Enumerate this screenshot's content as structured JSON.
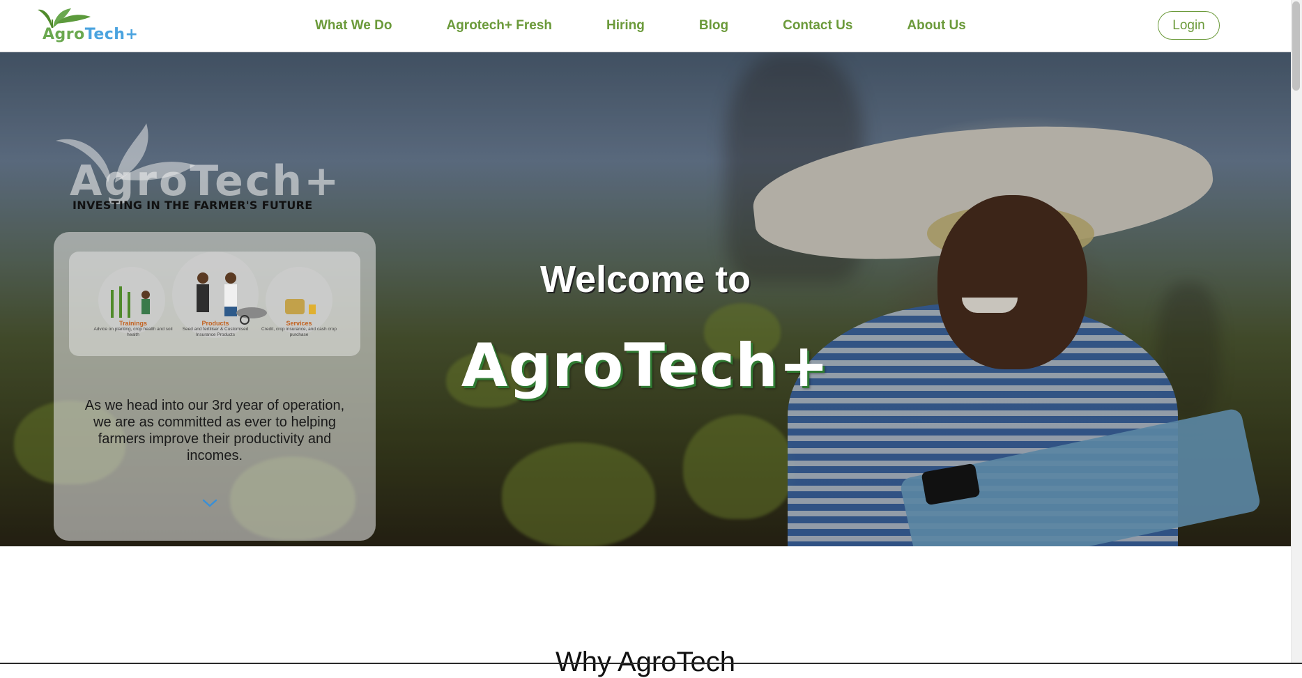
{
  "navbar": {
    "logo_text_agro": "Agro",
    "logo_text_tech": "Tech+",
    "links": [
      "What We Do",
      "Agrotech+ Fresh",
      "Hiring",
      "Blog",
      "Contact Us",
      "About Us"
    ],
    "login_label": "Login"
  },
  "hero": {
    "brand_watermark": "AgroTech+",
    "tagline": "INVESTING IN THE FARMER'S FUTURE",
    "illustration": {
      "columns": [
        {
          "title": "Trainings",
          "sub": "Advice on planting, crop health and soil health"
        },
        {
          "title": "Products",
          "sub": "Seed and fertiliser & Customised Insurance Products"
        },
        {
          "title": "Services",
          "sub": "Credit, crop insurance, and cash crop purchase"
        }
      ]
    },
    "card_text": "As we head into our 3rd year of operation, we are as committed as ever to helping farmers improve their productivity and incomes.",
    "welcome": "Welcome to",
    "title": "AgroTech+"
  },
  "section": {
    "heading": "Why AgroTech"
  },
  "colors": {
    "brand_green": "#6b9a3a",
    "brand_blue": "#4aa3df",
    "chevron_blue": "#3a8fd6"
  },
  "icons": [
    "leaf-logo-icon",
    "chevron-down-icon"
  ]
}
